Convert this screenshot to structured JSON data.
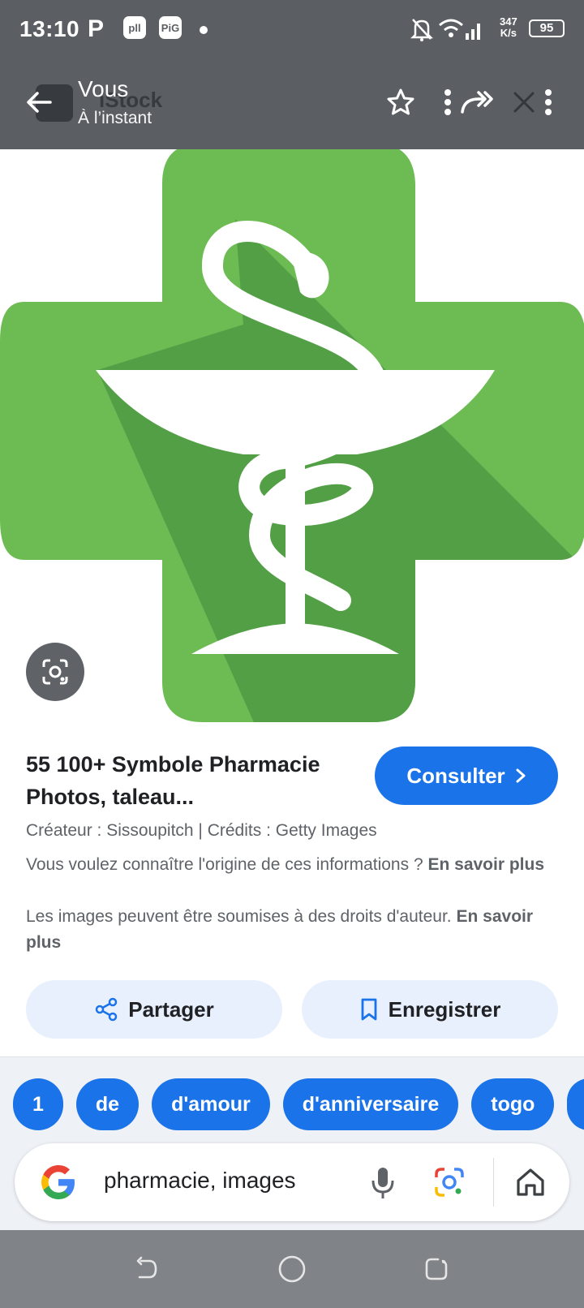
{
  "status_bar": {
    "time": "13:10",
    "app_indicator": "P",
    "box1": "pll",
    "box2": "PiG",
    "network_speed_value": "347",
    "network_speed_unit": "K/s",
    "battery": "95"
  },
  "header": {
    "title": "Vous",
    "subtitle": "À l’instant",
    "underlay_logo_text": "iStock"
  },
  "result": {
    "title": "55 100+ Symbole Pharmacie Photos, taleau...",
    "consult_label": "Consulter",
    "creator_line": "Créateur : Sissoupitch | Crédits : Getty Images",
    "origin_text": "Vous voulez connaître l'origine de ces informations ?",
    "origin_link": "En savoir plus",
    "rights_text": "Les images peuvent être soumises à des droits d'auteur.",
    "rights_link": "En savoir plus",
    "share_label": "Partager",
    "save_label": "Enregistrer"
  },
  "chips": [
    "1",
    "de",
    "d'amour",
    "d'anniversaire",
    "togo"
  ],
  "search": {
    "query": "pharmacie, images"
  },
  "colors": {
    "accent": "#1a73e8",
    "cross_green": "#6cbb53",
    "cross_shadow": "#4f9a44",
    "chip_bg": "#e8f0fe"
  },
  "icons": {
    "back": "arrow-left-icon",
    "star": "star-icon",
    "forward": "forward-icon",
    "close": "close-icon",
    "more": "more-vert-icon",
    "lens": "google-lens-icon",
    "share": "share-icon",
    "bookmark": "bookmark-icon",
    "mic": "mic-icon",
    "home": "home-icon"
  }
}
